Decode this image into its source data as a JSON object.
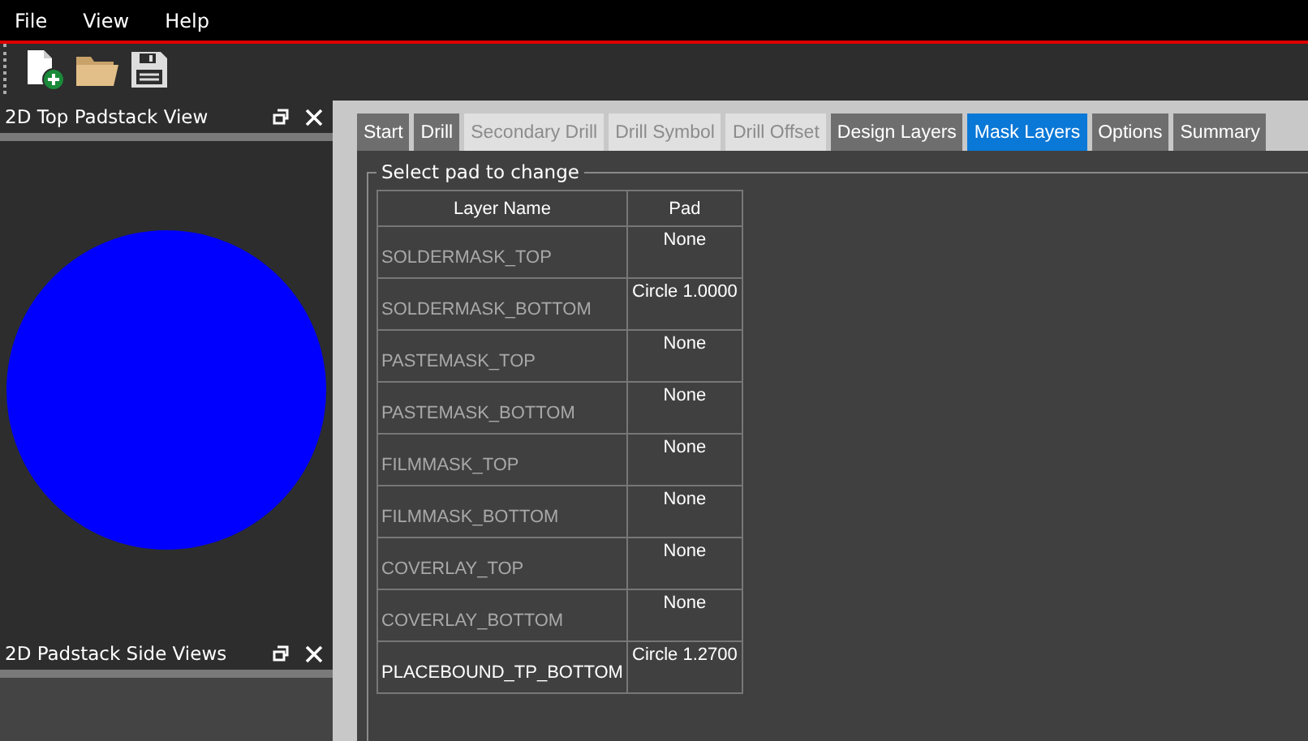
{
  "menu": [
    "File",
    "View",
    "Help"
  ],
  "panels": [
    {
      "title": "2D Top Padstack View"
    },
    {
      "title": "2D Padstack Side Views"
    }
  ],
  "tabs": [
    {
      "label": "Start",
      "selected": false,
      "disabled": false
    },
    {
      "label": "Drill",
      "selected": false,
      "disabled": false
    },
    {
      "label": "Secondary Drill",
      "selected": false,
      "disabled": true
    },
    {
      "label": "Drill Symbol",
      "selected": false,
      "disabled": true
    },
    {
      "label": "Drill Offset",
      "selected": false,
      "disabled": true
    },
    {
      "label": "Design Layers",
      "selected": false,
      "disabled": false
    },
    {
      "label": "Mask Layers",
      "selected": true,
      "disabled": false
    },
    {
      "label": "Options",
      "selected": false,
      "disabled": false
    },
    {
      "label": "Summary",
      "selected": false,
      "disabled": false
    }
  ],
  "group_title": "Select pad to change",
  "table": {
    "columns": [
      "Layer Name",
      "Pad"
    ],
    "rows": [
      {
        "layer": "SOLDERMASK_TOP",
        "pad": "None",
        "active": false
      },
      {
        "layer": "SOLDERMASK_BOTTOM",
        "pad": "Circle 1.0000",
        "active": false
      },
      {
        "layer": "PASTEMASK_TOP",
        "pad": "None",
        "active": false
      },
      {
        "layer": "PASTEMASK_BOTTOM",
        "pad": "None",
        "active": false
      },
      {
        "layer": "FILMMASK_TOP",
        "pad": "None",
        "active": false
      },
      {
        "layer": "FILMMASK_BOTTOM",
        "pad": "None",
        "active": false
      },
      {
        "layer": "COVERLAY_TOP",
        "pad": "None",
        "active": false
      },
      {
        "layer": "COVERLAY_BOTTOM",
        "pad": "None",
        "active": false
      },
      {
        "layer": "PLACEBOUND_TP_BOTTOM",
        "pad": "Circle 1.2700",
        "active": true
      }
    ]
  }
}
